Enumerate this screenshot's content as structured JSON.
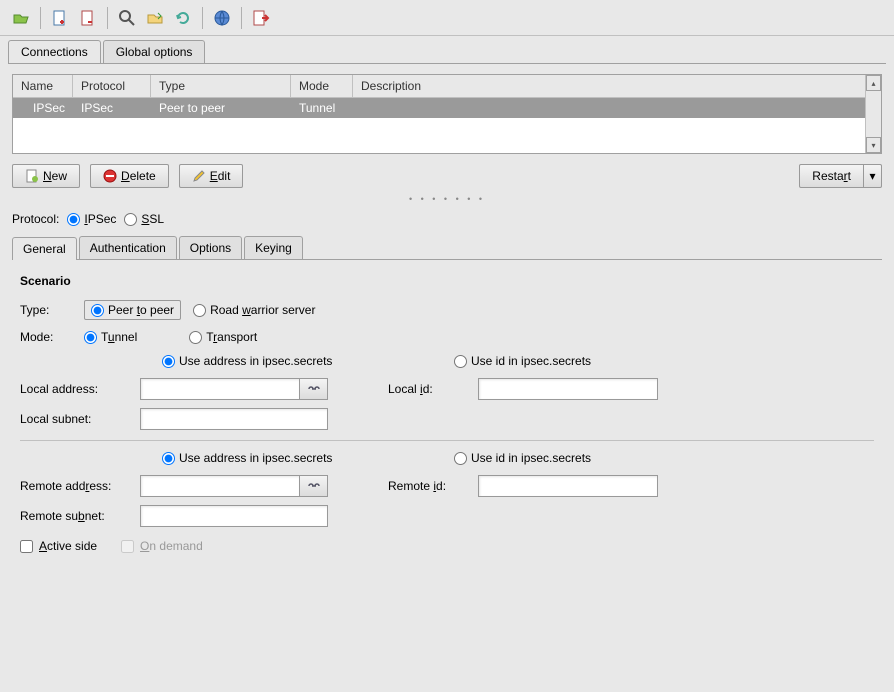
{
  "toolbar": {
    "icons": [
      "open-icon",
      "add-file-icon",
      "add-file2-icon",
      "zoom-icon",
      "folder-icon",
      "refresh-icon",
      "globe-icon",
      "exit-icon"
    ]
  },
  "main_tabs": {
    "connections": "Connections",
    "global_options": "Global options",
    "active": "connections"
  },
  "table": {
    "headers": {
      "name": "Name",
      "protocol": "Protocol",
      "type": "Type",
      "mode": "Mode",
      "description": "Description"
    },
    "rows": [
      {
        "name": "IPSec",
        "protocol": "IPSec",
        "type": "Peer to peer",
        "mode": "Tunnel",
        "description": ""
      }
    ]
  },
  "buttons": {
    "new": "New",
    "delete": "Delete",
    "edit": "Edit",
    "restart": "Restart"
  },
  "protocol": {
    "label": "Protocol:",
    "ipsec": "IPSec",
    "ssl": "SSL",
    "selected": "ipsec"
  },
  "sub_tabs": {
    "general": "General",
    "auth": "Authentication",
    "options": "Options",
    "keying": "Keying",
    "active": "general"
  },
  "scenario": {
    "title": "Scenario",
    "type_label": "Type:",
    "type_peer": "Peer to peer",
    "type_rw": "Road warrior server",
    "type_selected": "peer",
    "mode_label": "Mode:",
    "mode_tunnel": "Tunnel",
    "mode_transport": "Transport",
    "mode_selected": "tunnel",
    "local": {
      "use_addr": "Use address in ipsec.secrets",
      "use_id": "Use id in ipsec.secrets",
      "selected": "addr",
      "addr_label": "Local address:",
      "addr_value": "",
      "id_label": "Local id:",
      "id_value": "",
      "subnet_label": "Local subnet:",
      "subnet_value": ""
    },
    "remote": {
      "use_addr": "Use address in ipsec.secrets",
      "use_id": "Use id in ipsec.secrets",
      "selected": "addr",
      "addr_label": "Remote address:",
      "addr_value": "",
      "id_label": "Remote id:",
      "id_value": "",
      "subnet_label": "Remote subnet:",
      "subnet_value": ""
    },
    "active_side": "Active side",
    "on_demand": "On demand",
    "active_side_checked": false,
    "on_demand_checked": false
  }
}
